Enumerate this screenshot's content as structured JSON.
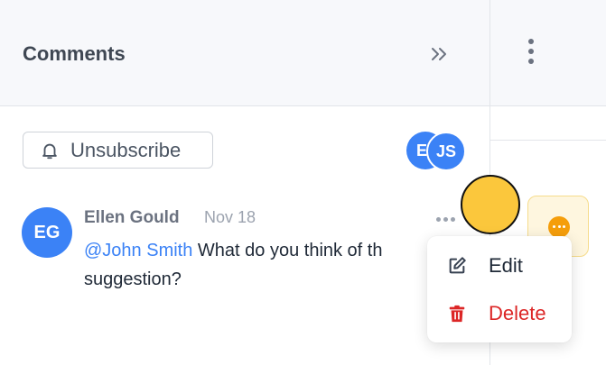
{
  "header": {
    "title": "Comments",
    "collapse_icon": "double-chevron-right-icon",
    "more_icon": "vertical-ellipsis-icon"
  },
  "subscription": {
    "button_label": "Unsubscribe",
    "icon": "bell-icon"
  },
  "subscribers": [
    {
      "initials": "E"
    },
    {
      "initials": "JS"
    }
  ],
  "comment": {
    "avatar_initials": "EG",
    "author": "Ellen Gould",
    "date": "Nov 18",
    "mention": "@John Smith",
    "text_line1": " What do you think of th",
    "text_line2": "suggestion?",
    "more_icon": "horizontal-ellipsis-icon"
  },
  "menu": {
    "items": [
      {
        "label": "Edit",
        "icon": "edit-icon"
      },
      {
        "label": "Delete",
        "icon": "trash-icon"
      }
    ]
  },
  "colors": {
    "accent_blue": "#3b82f6",
    "danger_red": "#dc2626",
    "cursor_yellow": "#fbc73c",
    "notice_orange": "#f59e0b"
  }
}
